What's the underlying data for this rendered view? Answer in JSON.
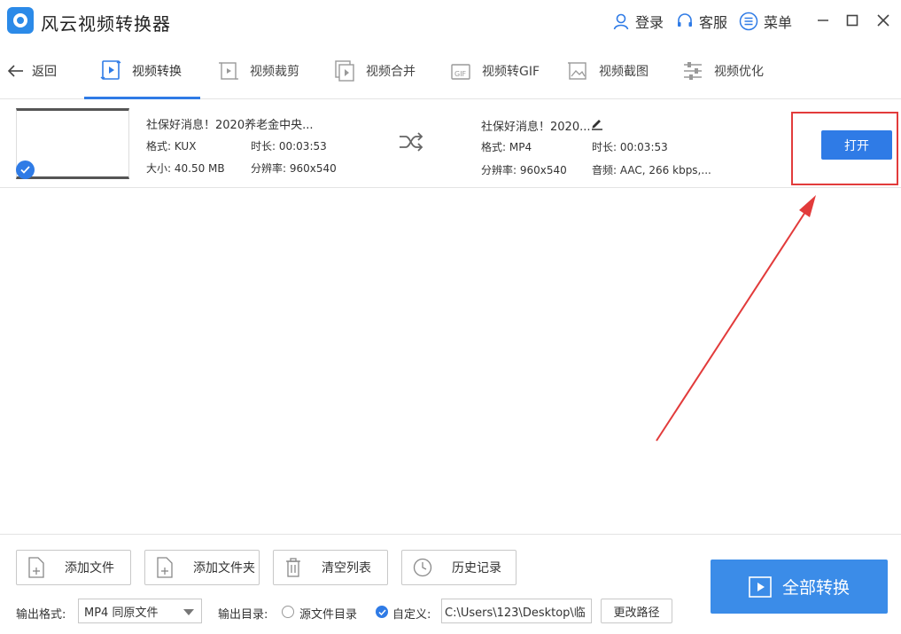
{
  "app": {
    "title": "风云视频转换器"
  },
  "top_actions": {
    "login": "登录",
    "service": "客服",
    "menu": "菜单"
  },
  "nav": {
    "back": "返回",
    "tabs": [
      "视频转换",
      "视频裁剪",
      "视频合并",
      "视频转GIF",
      "视频截图",
      "视频优化"
    ],
    "active_tab": "视频转换"
  },
  "file": {
    "source": {
      "name": "社保好消息！2020养老金中央...",
      "format": "格式: KUX",
      "duration": "时长: 00:03:53",
      "size": "大小: 40.50 MB",
      "resolution": "分辨率: 960x540"
    },
    "output": {
      "name": "社保好消息！2020...",
      "format": "格式: MP4",
      "duration": "时长: 00:03:53",
      "resolution": "分辨率: 960x540",
      "audio": "音频: AAC, 266 kbps,..."
    },
    "open_button": "打开"
  },
  "bottom": {
    "add_file": "添加文件",
    "add_folder": "添加文件夹",
    "clear_list": "清空列表",
    "history": "历史记录",
    "convert_all": "全部转换",
    "output_format_label": "输出格式:",
    "output_format_value": "MP4 同原文件",
    "output_dir_label": "输出目录:",
    "source_dir_option": "源文件目录",
    "custom_option": "自定义:",
    "custom_path": "C:\\Users\\123\\Desktop\\临",
    "change_path": "更改路径"
  },
  "colors": {
    "accent": "#2f7be6",
    "annotation": "#e23b3b"
  }
}
